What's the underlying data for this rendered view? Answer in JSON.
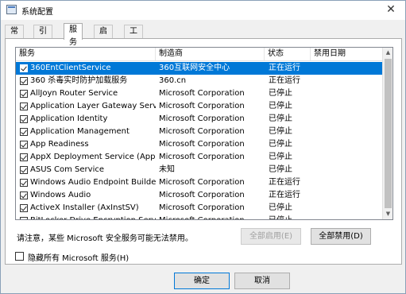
{
  "window": {
    "title": "系统配置",
    "close_glyph": "✕"
  },
  "tabs": [
    {
      "label": "常规"
    },
    {
      "label": "引导"
    },
    {
      "label": "服务"
    },
    {
      "label": "启动"
    },
    {
      "label": "工具"
    }
  ],
  "active_tab": "服务",
  "table": {
    "columns": [
      "服务",
      "制造商",
      "状态",
      "禁用日期"
    ],
    "rows": [
      {
        "checked": true,
        "name": "360EntClientService",
        "manufacturer": "360互联网安全中心",
        "status": "正在运行",
        "disabled_date": ""
      },
      {
        "checked": true,
        "name": "360 杀毒实时防护加载服务",
        "manufacturer": "360.cn",
        "status": "正在运行",
        "disabled_date": ""
      },
      {
        "checked": true,
        "name": "AllJoyn Router Service",
        "manufacturer": "Microsoft Corporation",
        "status": "已停止",
        "disabled_date": ""
      },
      {
        "checked": true,
        "name": "Application Layer Gateway Service",
        "manufacturer": "Microsoft Corporation",
        "status": "已停止",
        "disabled_date": ""
      },
      {
        "checked": true,
        "name": "Application Identity",
        "manufacturer": "Microsoft Corporation",
        "status": "已停止",
        "disabled_date": ""
      },
      {
        "checked": true,
        "name": "Application Management",
        "manufacturer": "Microsoft Corporation",
        "status": "已停止",
        "disabled_date": ""
      },
      {
        "checked": true,
        "name": "App Readiness",
        "manufacturer": "Microsoft Corporation",
        "status": "已停止",
        "disabled_date": ""
      },
      {
        "checked": true,
        "name": "AppX Deployment Service (AppX...",
        "manufacturer": "Microsoft Corporation",
        "status": "已停止",
        "disabled_date": ""
      },
      {
        "checked": true,
        "name": "ASUS Com Service",
        "manufacturer": "未知",
        "status": "已停止",
        "disabled_date": ""
      },
      {
        "checked": true,
        "name": "Windows Audio Endpoint Builder",
        "manufacturer": "Microsoft Corporation",
        "status": "正在运行",
        "disabled_date": ""
      },
      {
        "checked": true,
        "name": "Windows Audio",
        "manufacturer": "Microsoft Corporation",
        "status": "正在运行",
        "disabled_date": ""
      },
      {
        "checked": true,
        "name": "ActiveX Installer (AxInstSV)",
        "manufacturer": "Microsoft Corporation",
        "status": "已停止",
        "disabled_date": ""
      },
      {
        "checked": true,
        "name": "BitLocker Drive Encryption Service",
        "manufacturer": "Microsoft Corporation",
        "status": "已停止",
        "disabled_date": ""
      }
    ]
  },
  "notice": "请注意，某些 Microsoft 安全服务可能无法禁用。",
  "buttons": {
    "enable_all": "全部启用(E)",
    "disable_all": "全部禁用(D)",
    "ok": "确定",
    "cancel": "取消"
  },
  "hide_ms_label": "隐藏所有 Microsoft 服务(H)",
  "scroll": {
    "up": "▲",
    "down": "▼"
  },
  "colors": {
    "selection": "#0078d7"
  }
}
